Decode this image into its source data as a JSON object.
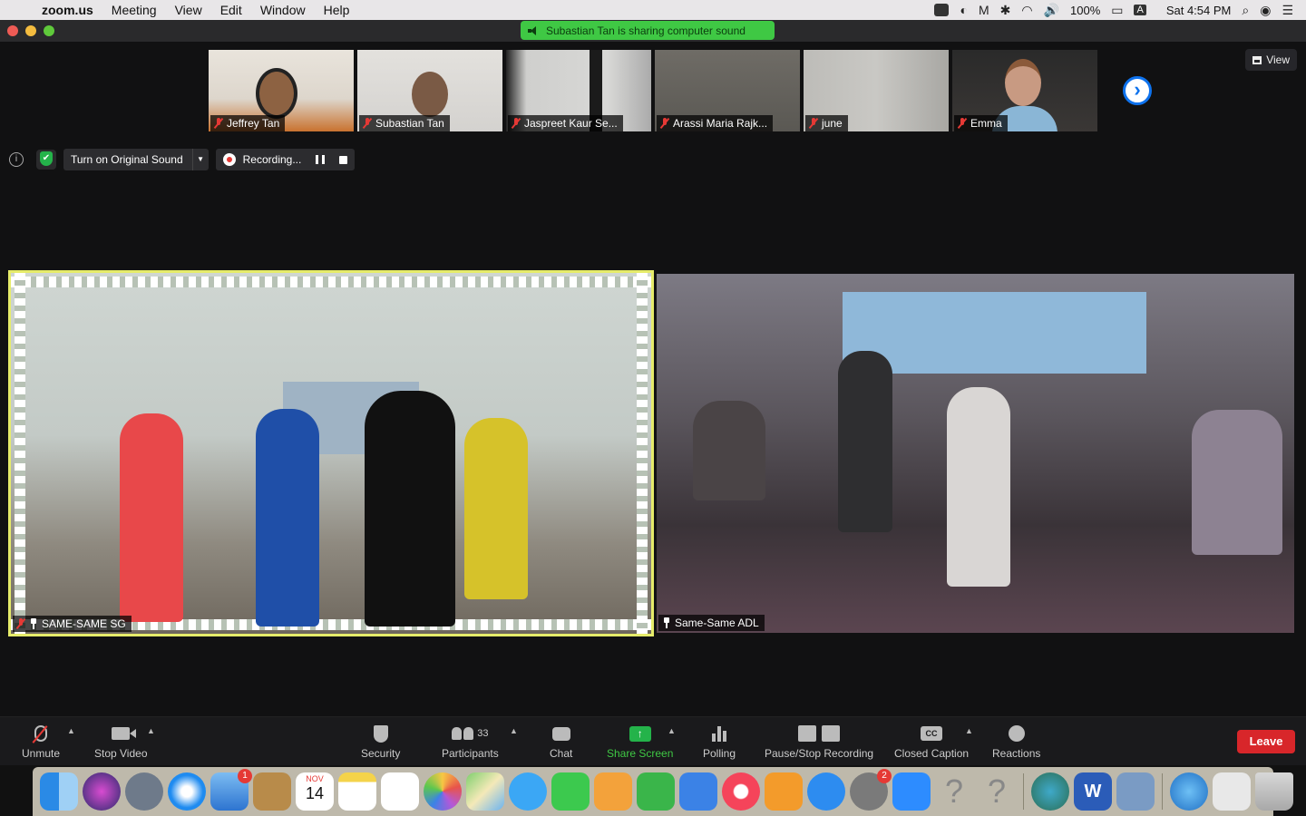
{
  "menubar": {
    "app": "zoom.us",
    "items": [
      "Meeting",
      "View",
      "Edit",
      "Window",
      "Help"
    ],
    "battery": "100%",
    "input_source": "A",
    "clock": "Sat 4:54 PM"
  },
  "banner": {
    "text": "Subastian Tan is sharing computer sound"
  },
  "thumbnails": [
    {
      "name": "Jeffrey Tan"
    },
    {
      "name": "Subastian Tan"
    },
    {
      "name": "Jaspreet Kaur Se..."
    },
    {
      "name": "Arassi Maria Rajk..."
    },
    {
      "name": "june"
    },
    {
      "name": "Emma"
    }
  ],
  "view_button": {
    "label": "View"
  },
  "meeting_controls": {
    "info_label": "i",
    "original_sound": "Turn on Original Sound",
    "recording": "Recording..."
  },
  "videos": {
    "left": {
      "name": "SAME-SAME SG"
    },
    "right": {
      "name": "Same-Same ADL"
    }
  },
  "toolbar": {
    "unmute": "Unmute",
    "stop_video": "Stop Video",
    "security": "Security",
    "participants": "Participants",
    "participants_count": "33",
    "chat": "Chat",
    "share_screen": "Share Screen",
    "polling": "Polling",
    "pause_stop_recording": "Pause/Stop Recording",
    "closed_caption": "Closed Caption",
    "cc_badge": "CC",
    "reactions": "Reactions",
    "leave": "Leave"
  },
  "dock": {
    "calendar_month": "NOV",
    "calendar_day": "14",
    "word_letter": "W",
    "mail_badge": "1",
    "prefs_badge": "2"
  },
  "colors": {
    "active_speaker_border": "#e6ec6a",
    "share_banner": "#3fc844",
    "leave": "#d8262a",
    "share_icon": "#24b34a",
    "next_arrow": "#0e72ed"
  }
}
